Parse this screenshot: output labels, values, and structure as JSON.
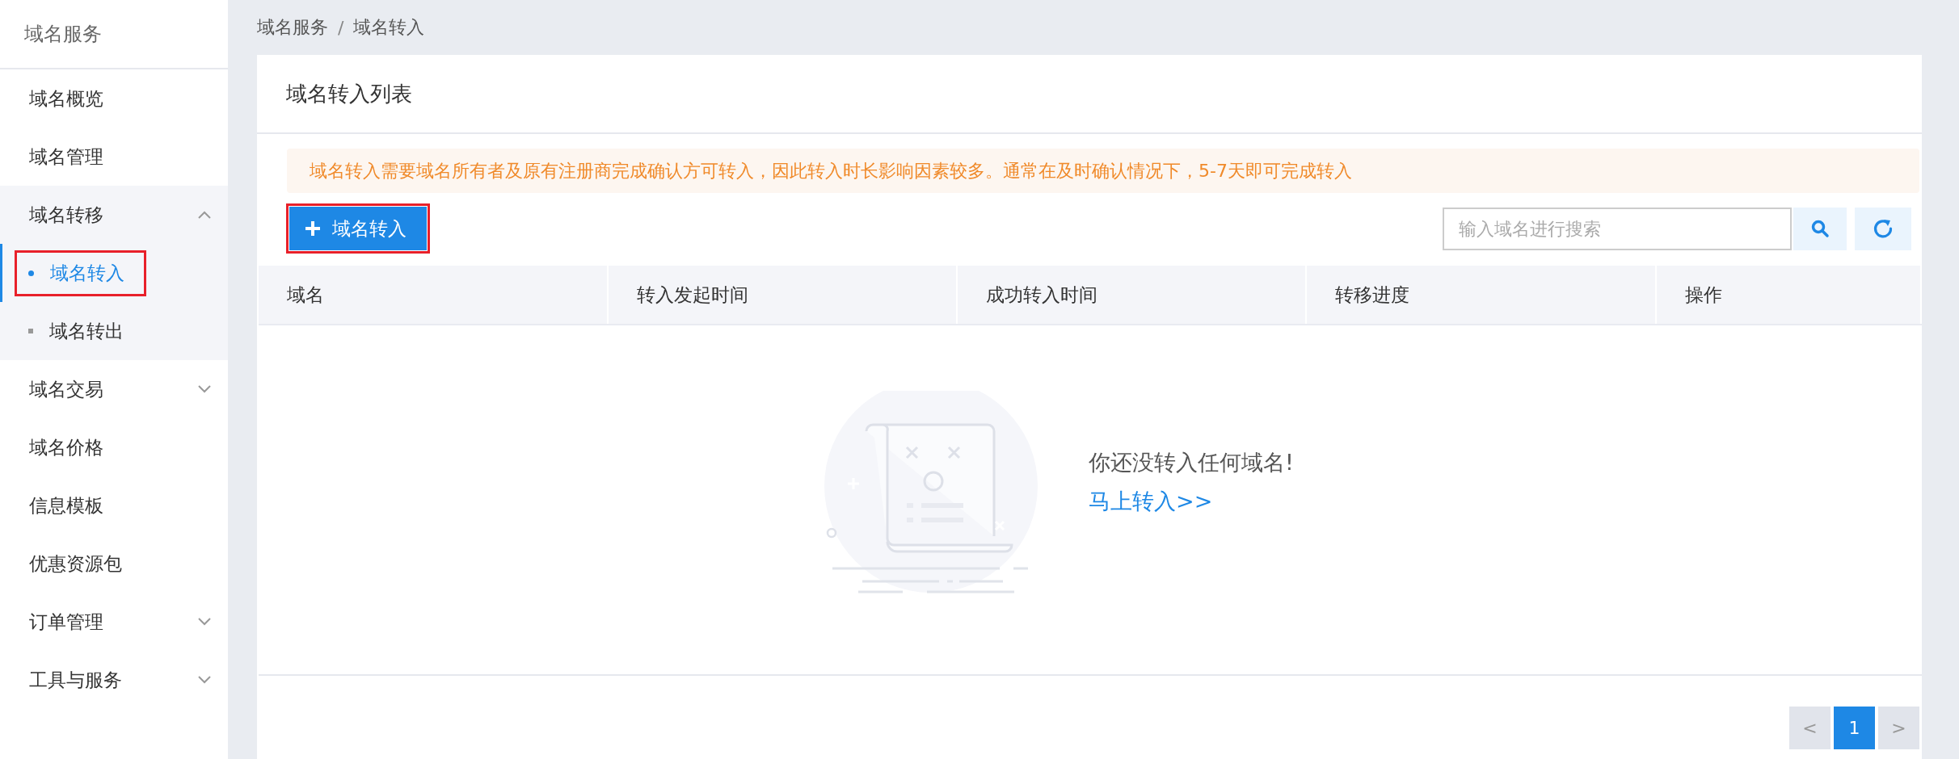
{
  "sidebar": {
    "title": "域名服务",
    "items": [
      {
        "label": "域名概览",
        "kind": "link",
        "selected": false
      },
      {
        "label": "域名管理",
        "kind": "link",
        "selected": false
      },
      {
        "label": "域名转移",
        "kind": "group",
        "expanded": true,
        "children": [
          {
            "label": "域名转入",
            "selected": true,
            "highlighted": true
          },
          {
            "label": "域名转出",
            "selected": false,
            "highlighted": false
          }
        ]
      },
      {
        "label": "域名交易",
        "kind": "group",
        "expanded": false
      },
      {
        "label": "域名价格",
        "kind": "link",
        "selected": false
      },
      {
        "label": "信息模板",
        "kind": "link",
        "selected": false
      },
      {
        "label": "优惠资源包",
        "kind": "link",
        "selected": false
      },
      {
        "label": "订单管理",
        "kind": "group",
        "expanded": false
      },
      {
        "label": "工具与服务",
        "kind": "group",
        "expanded": false
      }
    ]
  },
  "breadcrumb": {
    "items": [
      "域名服务",
      "域名转入"
    ],
    "separator": "/"
  },
  "card": {
    "title": "域名转入列表",
    "notice": "域名转入需要域名所有者及原有注册商完成确认方可转入，因此转入时长影响因素较多。通常在及时确认情况下，5-7天即可完成转入",
    "add_button": {
      "label": "域名转入",
      "highlighted": true
    },
    "search": {
      "placeholder": "输入域名进行搜索"
    },
    "table": {
      "columns": [
        "域名",
        "转入发起时间",
        "成功转入时间",
        "转移进度",
        "操作"
      ]
    },
    "empty": {
      "message": "你还没转入任何域名!",
      "link": "马上转入>>"
    },
    "pagination": {
      "prev": "<",
      "next": ">",
      "pages": [
        {
          "label": "1",
          "selected": true
        }
      ]
    }
  }
}
